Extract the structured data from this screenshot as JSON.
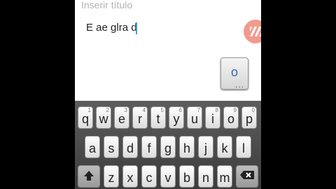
{
  "note_editor": {
    "title_placeholder": "Inserir título",
    "body_text": "E ae glra d"
  },
  "suggestion": {
    "letter": "o",
    "more_indicator": "..."
  },
  "keyboard": {
    "row1": [
      {
        "key": "q",
        "alt": "1"
      },
      {
        "key": "w",
        "alt": "2"
      },
      {
        "key": "e",
        "alt": "3"
      },
      {
        "key": "r",
        "alt": "4"
      },
      {
        "key": "t",
        "alt": "5"
      },
      {
        "key": "y",
        "alt": "6"
      },
      {
        "key": "u",
        "alt": "7"
      },
      {
        "key": "i",
        "alt": "8"
      },
      {
        "key": "o",
        "alt": "9"
      },
      {
        "key": "p",
        "alt": "0"
      }
    ],
    "row2": [
      "a",
      "s",
      "d",
      "f",
      "g",
      "h",
      "j",
      "k",
      "l"
    ],
    "row3": [
      "z",
      "x",
      "c",
      "v",
      "b",
      "n",
      "m"
    ],
    "shift_icon": "shift-arrow-icon",
    "backspace_icon": "backspace-icon"
  },
  "colors": {
    "caret": "#3aa0d8",
    "suggestion_letter": "#2f68b3",
    "fab": "#f08a7a"
  }
}
